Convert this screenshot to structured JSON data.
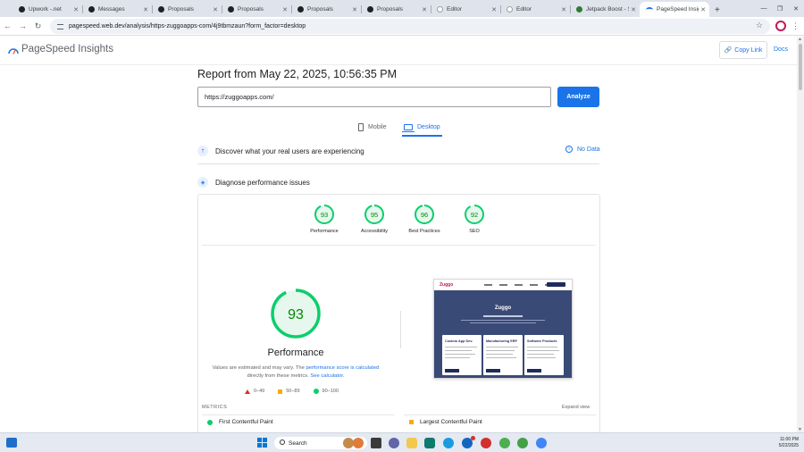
{
  "browser": {
    "tabs": [
      {
        "title": "Upwork -.net",
        "icon": "upwork-icon"
      },
      {
        "title": "Messages",
        "icon": "upwork-icon"
      },
      {
        "title": "Proposals",
        "icon": "upwork-icon"
      },
      {
        "title": "Proposals",
        "icon": "upwork-icon"
      },
      {
        "title": "Proposals",
        "icon": "upwork-icon"
      },
      {
        "title": "Proposals",
        "icon": "upwork-icon"
      },
      {
        "title": "Editor",
        "icon": "editor-icon"
      },
      {
        "title": "Editor",
        "icon": "editor-icon"
      },
      {
        "title": "Jetpack Boost - S",
        "icon": "jetpack-icon"
      },
      {
        "title": "PageSpeed Insigh",
        "icon": "pagespeed-icon",
        "active": true
      }
    ],
    "new_tab": "+",
    "window": {
      "minimize": "—",
      "maximize": "❐",
      "close": "✕"
    },
    "nav": {
      "back": "←",
      "forward": "→",
      "reload": "↻"
    },
    "url": "pagespeed.web.dev/analysis/https-zuggoapps-com/4j9tbmzaun?form_factor=desktop",
    "star": "☆",
    "menu": "⋮"
  },
  "psi": {
    "brand": "PageSpeed Insights",
    "copy_link": "Copy Link",
    "docs": "Docs",
    "report_title": "Report from May 22, 2025, 10:56:35 PM",
    "url_input": "https://zuggoapps.com/",
    "analyze": "Analyze",
    "device_tabs": {
      "mobile": "Mobile",
      "desktop": "Desktop"
    },
    "discover": "Discover what your real users are experiencing",
    "no_data": "No Data",
    "diagnose": "Diagnose performance issues",
    "scores": [
      {
        "label": "Performance",
        "value": 93
      },
      {
        "label": "Accessibility",
        "value": 95
      },
      {
        "label": "Best Practices",
        "value": 96
      },
      {
        "label": "SEO",
        "value": 92
      }
    ],
    "main_score": {
      "value": 93,
      "label": "Performance"
    },
    "estimate": {
      "text1": "Values are estimated and may vary. The ",
      "link1": "performance score is calculated",
      "text2": " directly from these metrics. ",
      "link2": "See calculator."
    },
    "legend": {
      "poor": "0–49",
      "average": "50–89",
      "good": "90–100"
    },
    "colors": {
      "good": "#0cce6b",
      "good_fill": "#e6f8ee",
      "good_text": "#008800",
      "accent": "#1a73e8"
    },
    "preview": {
      "brand": "Zuggo",
      "hero_title": "Zuggo",
      "cards": [
        "Custom App Dev.",
        "Manufacturing ERP",
        "Software Products"
      ]
    },
    "metrics_label": "METRICS",
    "expand": "Expand view",
    "metrics": {
      "fcp": "First Contentful Paint",
      "lcp": "Largest Contentful Paint"
    }
  },
  "taskbar": {
    "search": "Search",
    "time": "11:00 PM",
    "date": "5/22/2025"
  }
}
